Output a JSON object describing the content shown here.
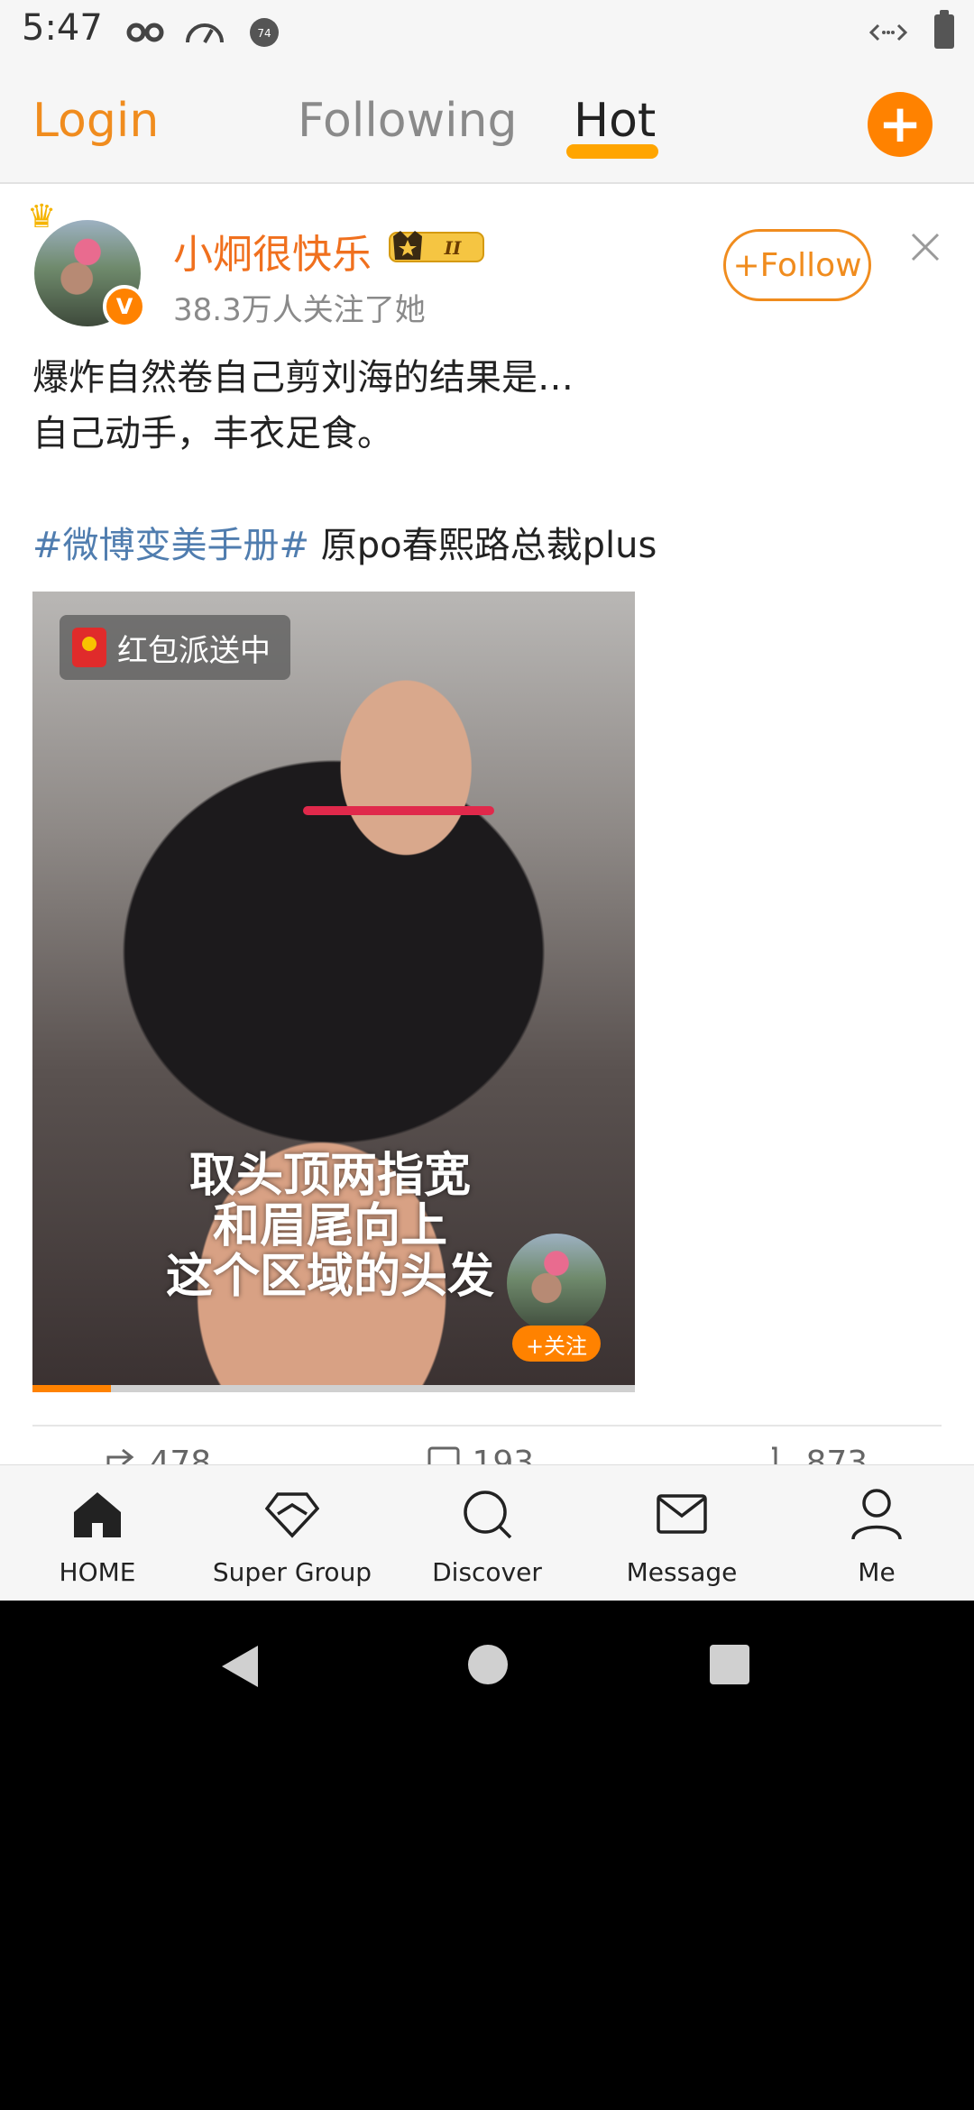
{
  "status_bar": {
    "time": "5:47"
  },
  "top_nav": {
    "login": "Login",
    "following": "Following",
    "hot": "Hot",
    "compose": "+"
  },
  "post": {
    "username": "小炯很快乐",
    "followers": "38.3万人关注了她",
    "follow_label": "+Follow",
    "text_line1": "爆炸自然卷自己剪刘海的结果是…",
    "text_line2": "自己动手，丰衣足食。",
    "hashtag": "#微博变美手册#",
    "text_after_hashtag": " 原po春熙路总裁plus",
    "video": {
      "red_packet_label": "红包派送中",
      "subtitle_line1": "取头顶两指宽",
      "subtitle_line2": "和眉尾向上",
      "subtitle_line3": "这个区域的头发",
      "follow_label": "+关注",
      "progress": 0.13
    },
    "actions": {
      "repost": "478",
      "comment": "193",
      "like": "873"
    }
  },
  "bottom_nav": [
    {
      "label": "HOME",
      "icon": "home-icon"
    },
    {
      "label": "Super Group",
      "icon": "diamond-icon"
    },
    {
      "label": "Discover",
      "icon": "search-icon"
    },
    {
      "label": "Message",
      "icon": "mail-icon"
    },
    {
      "label": "Me",
      "icon": "person-icon"
    }
  ],
  "colors": {
    "accent": "#ff8200",
    "username": "#f0701e",
    "hashtag": "#507daf"
  }
}
